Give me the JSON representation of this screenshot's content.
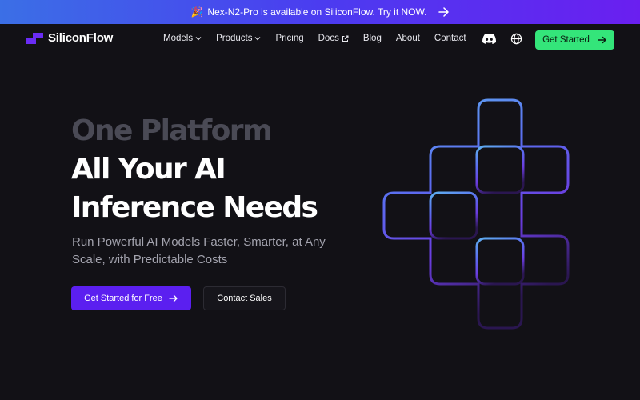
{
  "banner": {
    "emoji": "🎉",
    "text": "Nex-N2-Pro is available on SiliconFlow. Try it NOW."
  },
  "nav": {
    "brand": "SiliconFlow",
    "links": [
      {
        "label": "Models",
        "has_dropdown": true
      },
      {
        "label": "Products",
        "has_dropdown": true
      },
      {
        "label": "Pricing"
      },
      {
        "label": "Docs",
        "external": true
      },
      {
        "label": "Blog"
      },
      {
        "label": "About"
      },
      {
        "label": "Contact"
      }
    ],
    "icons": [
      "discord-icon",
      "globe-icon"
    ],
    "cta_label": "Get Started"
  },
  "hero": {
    "title_line1": "One Platform",
    "title_line2": "All Your AI",
    "title_line3": "Inference Needs",
    "subtitle": "Run Powerful AI Models Faster, Smarter, at Any Scale,  with Predictable Costs",
    "primary_cta": "Get Started for Free",
    "secondary_cta": "Contact Sales"
  },
  "colors": {
    "background": "#121116",
    "accent_green": "#34e57a",
    "accent_purple": "#5b1ff0",
    "banner_start": "#3b6fe6",
    "banner_end": "#6a1ff0"
  }
}
